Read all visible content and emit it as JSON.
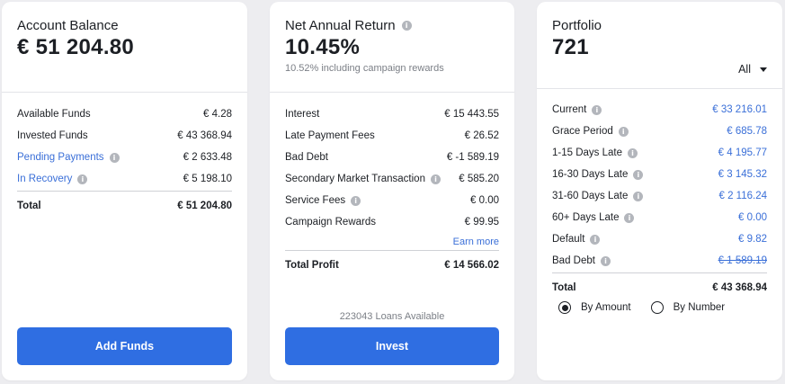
{
  "account": {
    "title": "Account Balance",
    "value": "€ 51 204.80",
    "rows": [
      {
        "label": "Available Funds",
        "value": "€ 4.28"
      },
      {
        "label": "Invested Funds",
        "value": "€ 43 368.94"
      },
      {
        "label": "Pending Payments",
        "value": "€ 2 633.48"
      },
      {
        "label": "In Recovery",
        "value": "€ 5 198.10"
      }
    ],
    "total_label": "Total",
    "total_value": "€ 51 204.80",
    "button": "Add Funds"
  },
  "returns": {
    "title": "Net Annual Return",
    "value": "10.45%",
    "subtitle": "10.52% including campaign rewards",
    "rows": [
      {
        "label": "Interest",
        "value": "€ 15 443.55"
      },
      {
        "label": "Late Payment Fees",
        "value": "€ 26.52"
      },
      {
        "label": "Bad Debt",
        "value": "€ -1 589.19"
      },
      {
        "label": "Secondary Market Transaction",
        "value": "€ 585.20"
      },
      {
        "label": "Service Fees",
        "value": "€ 0.00"
      },
      {
        "label": "Campaign Rewards",
        "value": "€ 99.95"
      }
    ],
    "earn_more": "Earn more",
    "total_label": "Total Profit",
    "total_value": "€ 14 566.02",
    "loans_available": "223043 Loans Available",
    "button": "Invest"
  },
  "portfolio": {
    "title": "Portfolio",
    "value": "721",
    "filter": "All",
    "rows": [
      {
        "label": "Current",
        "value": "€ 33 216.01"
      },
      {
        "label": "Grace Period",
        "value": "€ 685.78"
      },
      {
        "label": "1-15 Days Late",
        "value": "€ 4 195.77"
      },
      {
        "label": "16-30 Days Late",
        "value": "€ 3 145.32"
      },
      {
        "label": "31-60 Days Late",
        "value": "€ 2 116.24"
      },
      {
        "label": "60+ Days Late",
        "value": "€ 0.00"
      },
      {
        "label": "Default",
        "value": "€ 9.82"
      },
      {
        "label": "Bad Debt",
        "value": "€ 1 589.19"
      }
    ],
    "total_label": "Total",
    "total_value": "€ 43 368.94",
    "radio_amount": "By Amount",
    "radio_number": "By Number"
  },
  "colors": {
    "accent": "#2f6ee2",
    "link": "#3a6fd8"
  }
}
